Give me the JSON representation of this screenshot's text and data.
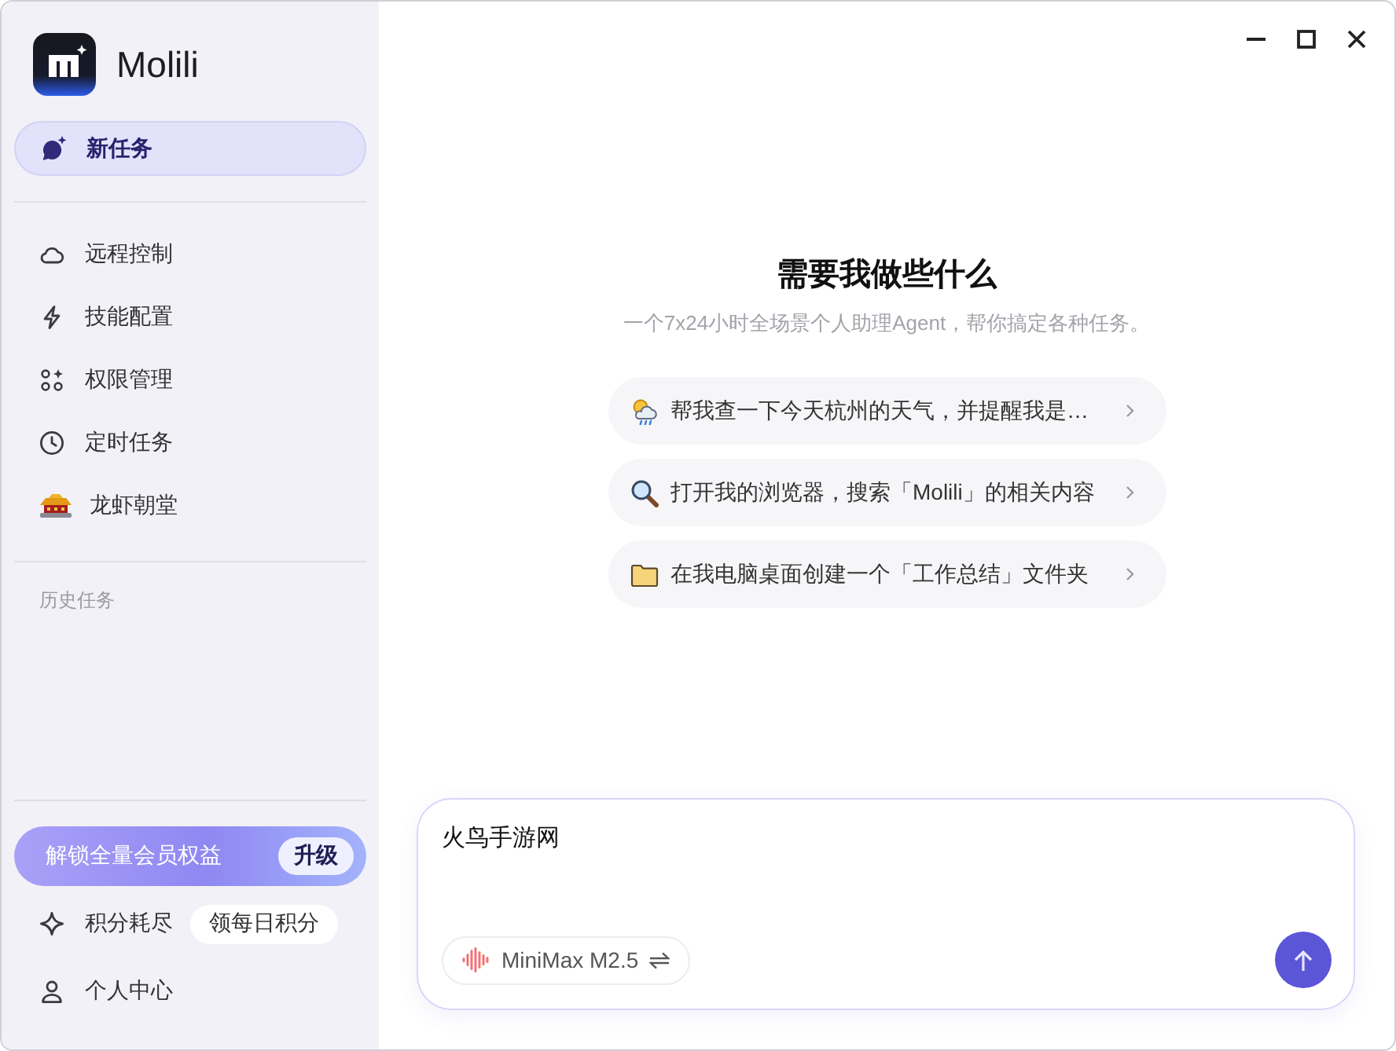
{
  "sidebar": {
    "brand": "Molili",
    "new_task": {
      "label": "新任务",
      "selected": true
    },
    "nav": [
      {
        "label": "远程控制",
        "selected": false
      },
      {
        "label": "技能配置",
        "selected": false
      },
      {
        "label": "权限管理",
        "selected": false
      },
      {
        "label": "定时任务",
        "selected": false
      },
      {
        "label": "龙虾朝堂",
        "selected": false
      }
    ],
    "history_heading": "历史任务",
    "upgrade": {
      "text": "解锁全量会员权益",
      "button": "升级"
    },
    "credits": {
      "status": "积分耗尽",
      "button": "领每日积分"
    },
    "profile": {
      "label": "个人中心"
    }
  },
  "main": {
    "heading": "需要我做些什么",
    "subtitle": "一个7x24小时全场景个人助理Agent，帮你搞定各种任务。",
    "suggestions": [
      {
        "text": "帮我查一下今天杭州的天气，并提醒我是…"
      },
      {
        "text": "打开我的浏览器，搜索「Molili」的相关内容"
      },
      {
        "text": "在我电脑桌面创建一个「工作总结」文件夹"
      }
    ],
    "composer": {
      "value": "火鸟手游网",
      "model": "MiniMax M2.5"
    }
  }
}
